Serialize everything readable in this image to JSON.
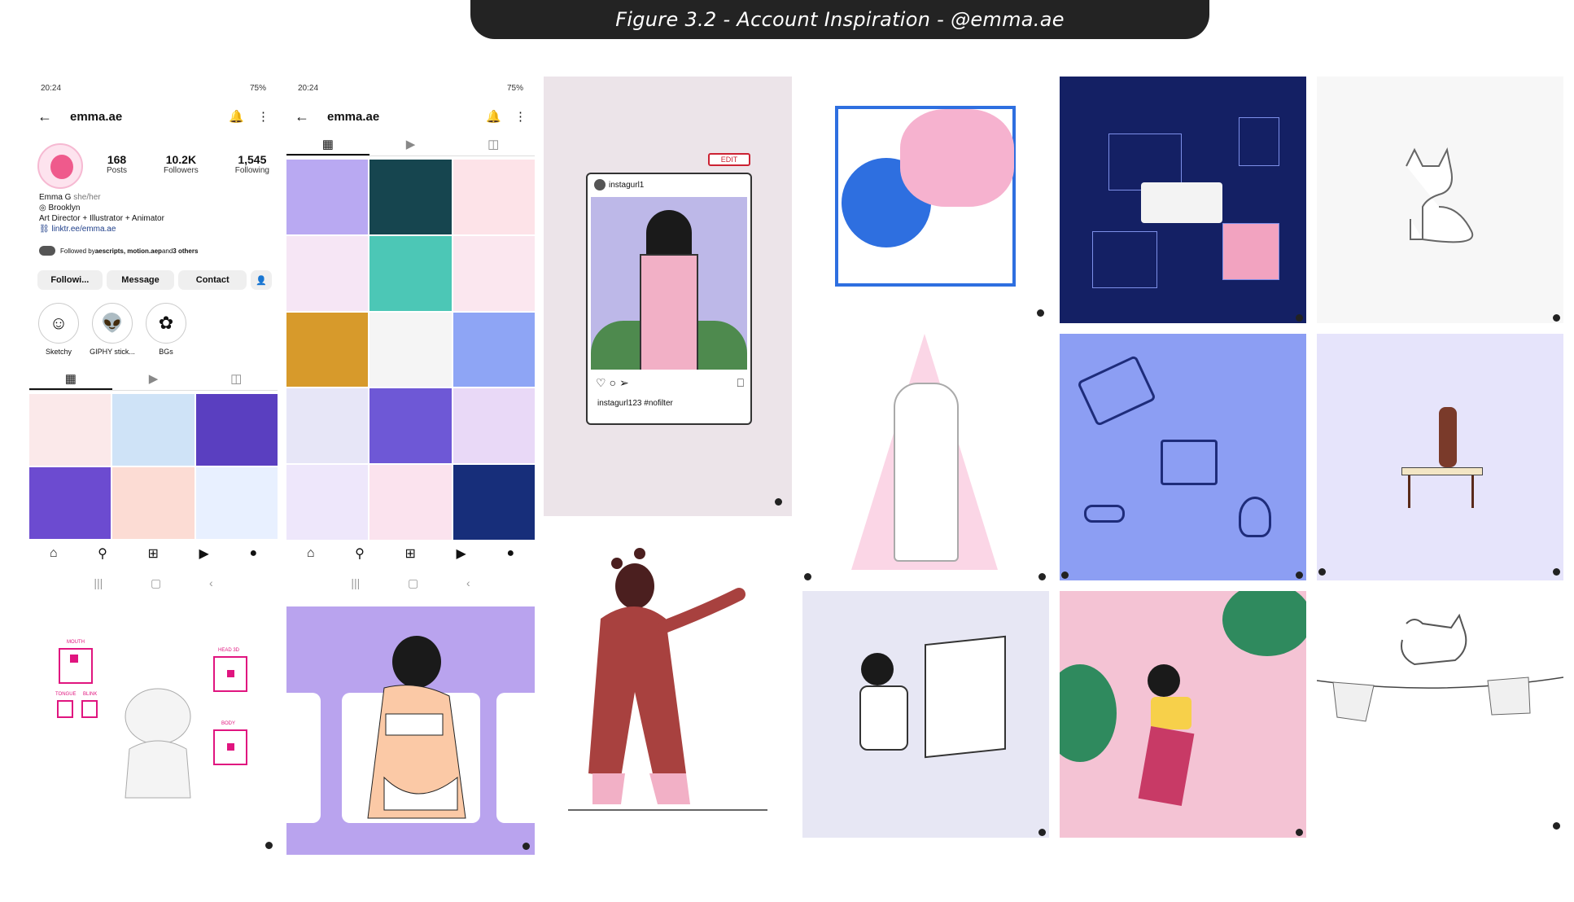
{
  "figure_caption": "Figure 3.2 - Account Inspiration - @emma.ae",
  "phone1": {
    "status_time": "20:24",
    "status_right": "75%",
    "username": "emma.ae",
    "stats": [
      {
        "value": "168",
        "label": "Posts"
      },
      {
        "value": "10.2K",
        "label": "Followers"
      },
      {
        "value": "1,545",
        "label": "Following"
      }
    ],
    "bio_name": "Emma G",
    "bio_pronouns": "she/her",
    "bio_location": "Brooklyn",
    "bio_role": "Art Director + Illustrator + Animator",
    "bio_link": "linktr.ee/emma.ae",
    "followed_by_prefix": "Followed by ",
    "followed_by_names": "aescripts, motion.aep",
    "followed_by_suffix": " and ",
    "followed_by_others": "3 others",
    "buttons": {
      "following": "Followi...",
      "message": "Message",
      "contact": "Contact"
    },
    "highlights": [
      "Sketchy",
      "GIPHY stick...",
      "BGs"
    ]
  },
  "phone2": {
    "status_time": "20:24",
    "status_right": "75%",
    "username": "emma.ae"
  },
  "post1": {
    "handle": "instagurl1",
    "edit_label": "EDIT",
    "caption": "instagurl123 #nofilter"
  },
  "rig": {
    "mouth": "MOUTH",
    "tongue": "TONGUE",
    "blink": "BLINK",
    "head": "HEAD 3D",
    "body": "BODY"
  },
  "colors": {
    "accent": "#e0157f",
    "lavender": "#b49ff0",
    "blue": "#2e6fe0",
    "navy": "#0f1a4a",
    "pink": "#f2b8cf"
  }
}
